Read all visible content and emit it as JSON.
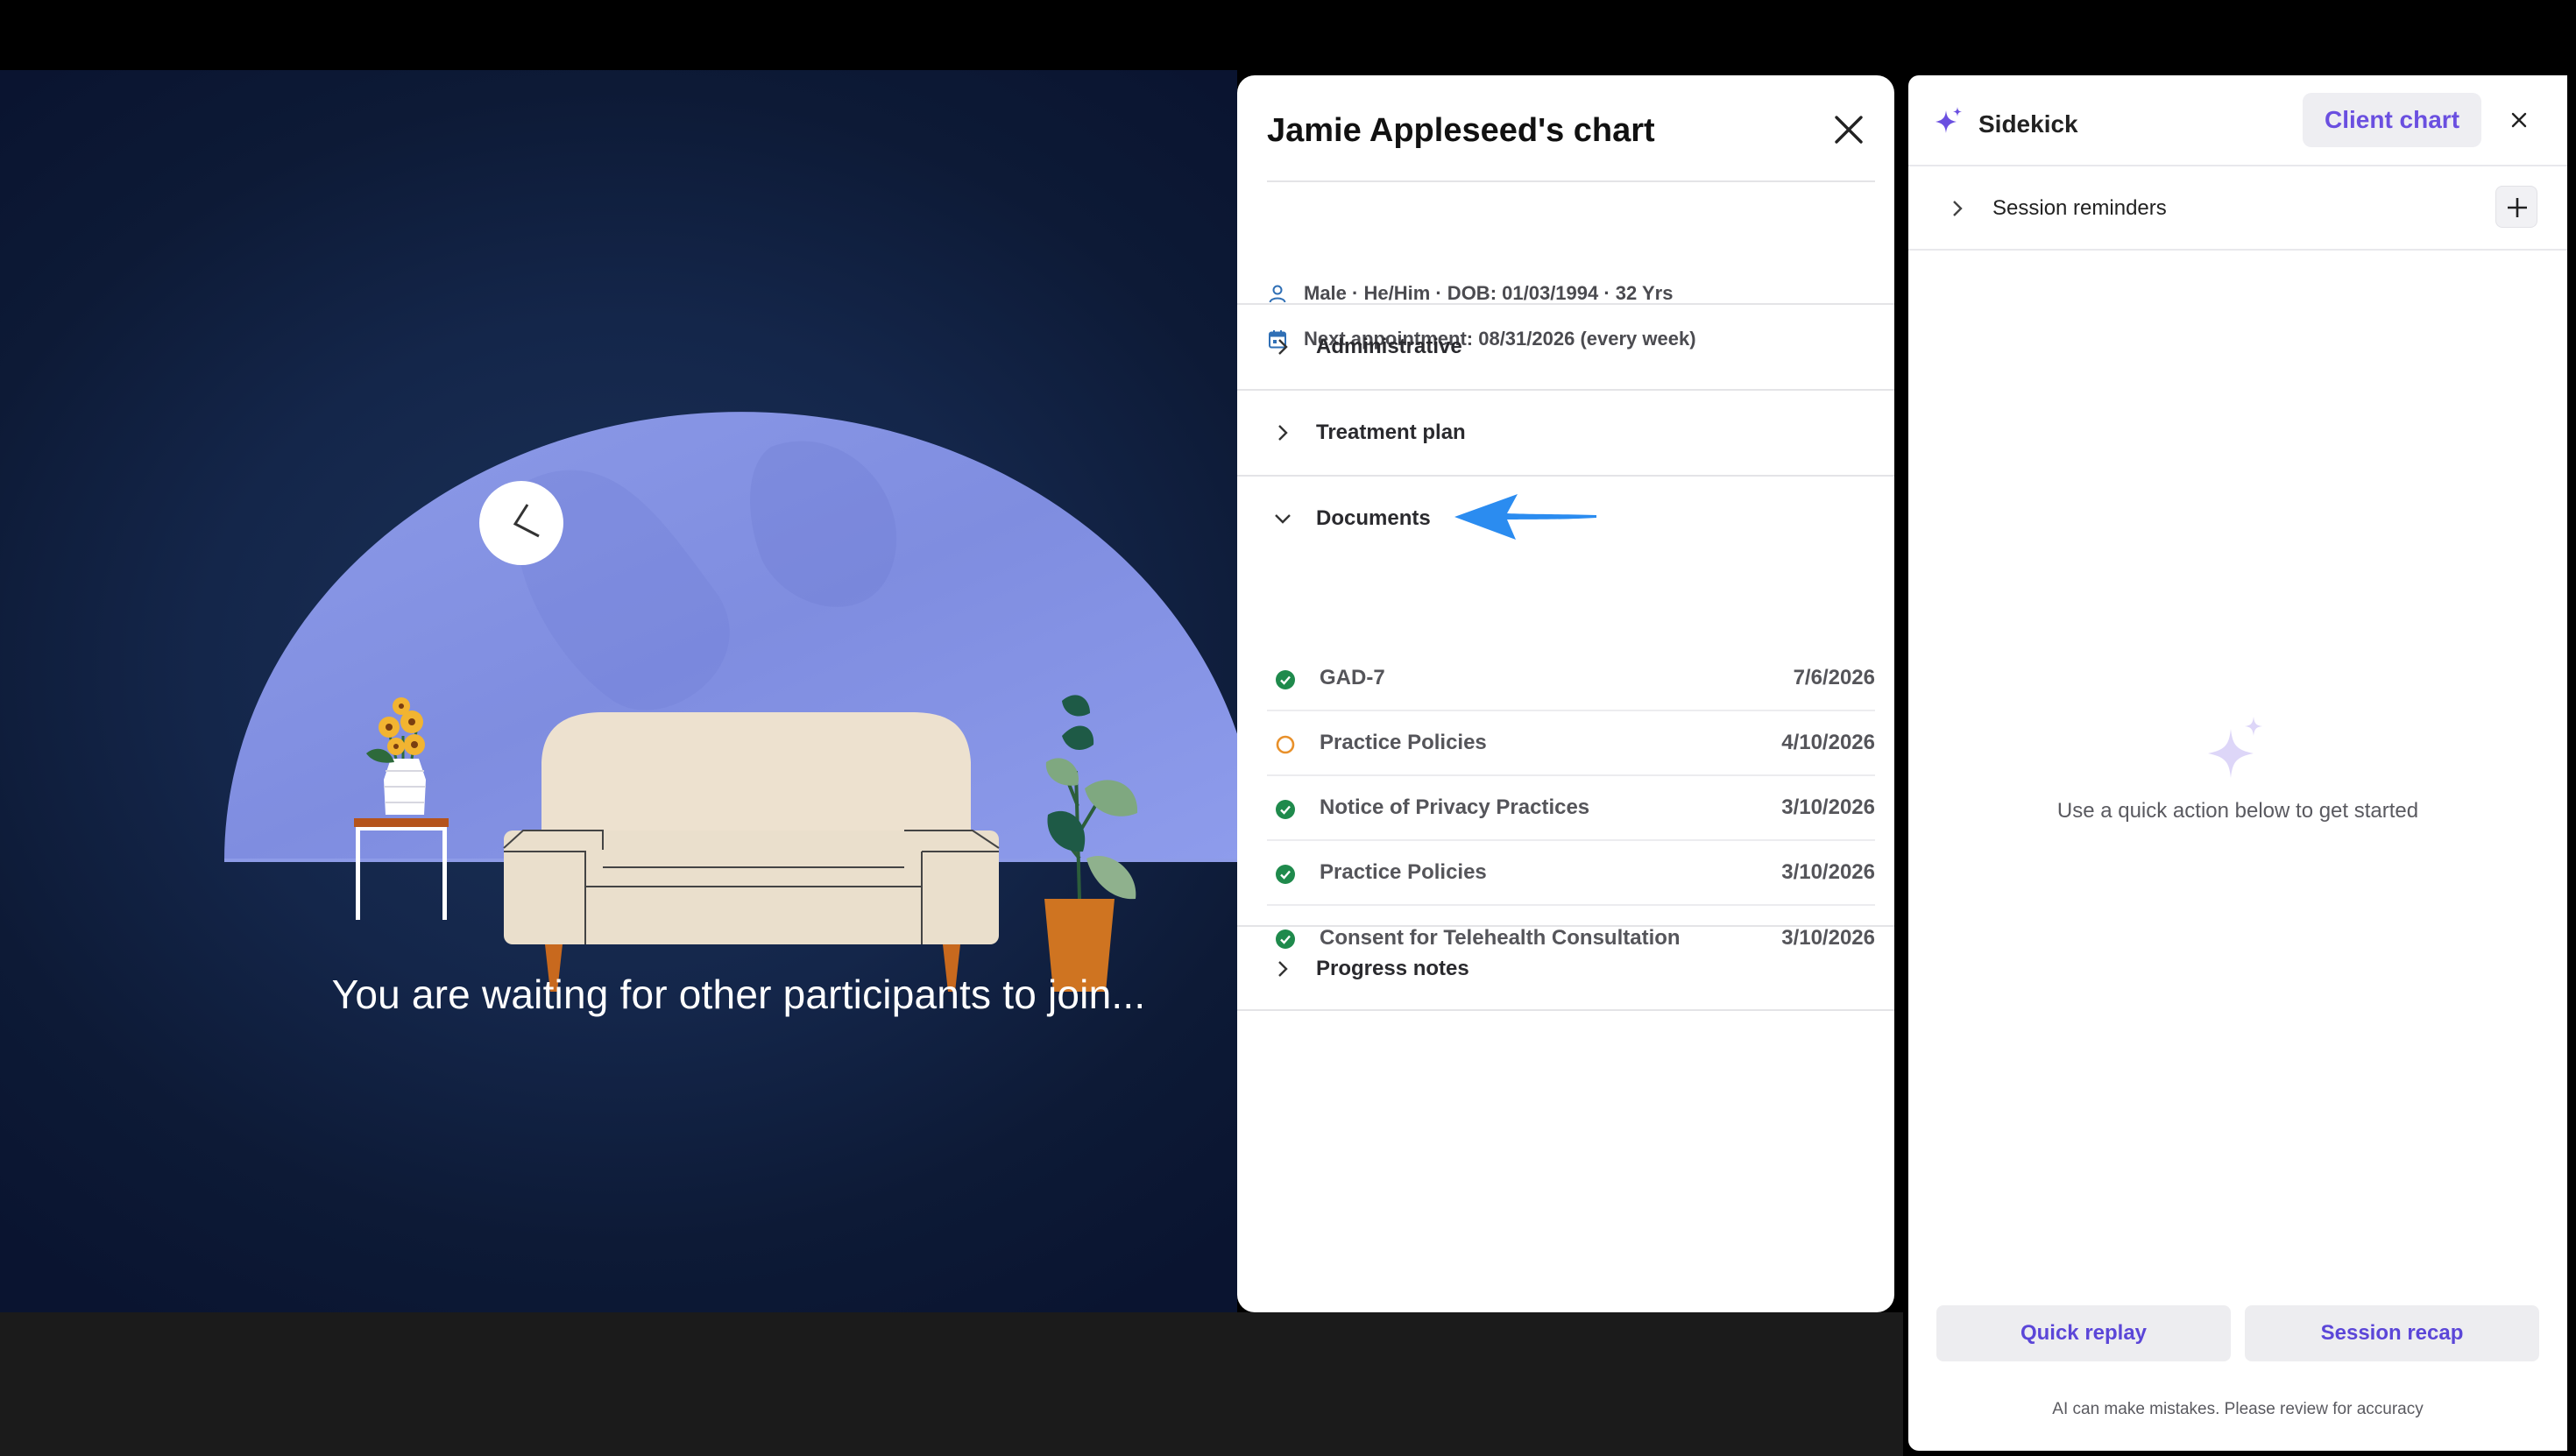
{
  "video": {
    "waiting_message": "You are waiting for other participants to join..."
  },
  "chart_panel": {
    "title": "Jamie Appleseed's chart",
    "patient_info": "Male · He/Him · DOB: 01/03/1994 · 32 Yrs",
    "next_appointment": "Next appointment: 08/31/2026 (every week)",
    "sections": {
      "administrative": "Administrative",
      "treatment_plan": "Treatment plan",
      "documents": "Documents",
      "progress_notes": "Progress notes"
    },
    "documents": [
      {
        "name": "GAD-7",
        "date": "7/6/2026",
        "status": "complete"
      },
      {
        "name": "Practice Policies",
        "date": "4/10/2026",
        "status": "pending"
      },
      {
        "name": "Notice of Privacy Practices",
        "date": "3/10/2026",
        "status": "complete"
      },
      {
        "name": "Practice Policies",
        "date": "3/10/2026",
        "status": "complete"
      },
      {
        "name": "Consent for Telehealth Consultation",
        "date": "3/10/2026",
        "status": "complete"
      }
    ],
    "colors": {
      "complete": "#1f8a4c",
      "pending": "#e8902a",
      "annotation_arrow": "#2b8cf0"
    }
  },
  "sidekick": {
    "title": "Sidekick",
    "active_tab": "Client chart",
    "session_reminders": "Session reminders",
    "empty_state": "Use a quick action below to get started",
    "quick_actions": [
      "Quick replay",
      "Session recap"
    ],
    "disclaimer": "AI can make mistakes. Please review for accuracy",
    "colors": {
      "accent": "#6a4fe0"
    }
  }
}
